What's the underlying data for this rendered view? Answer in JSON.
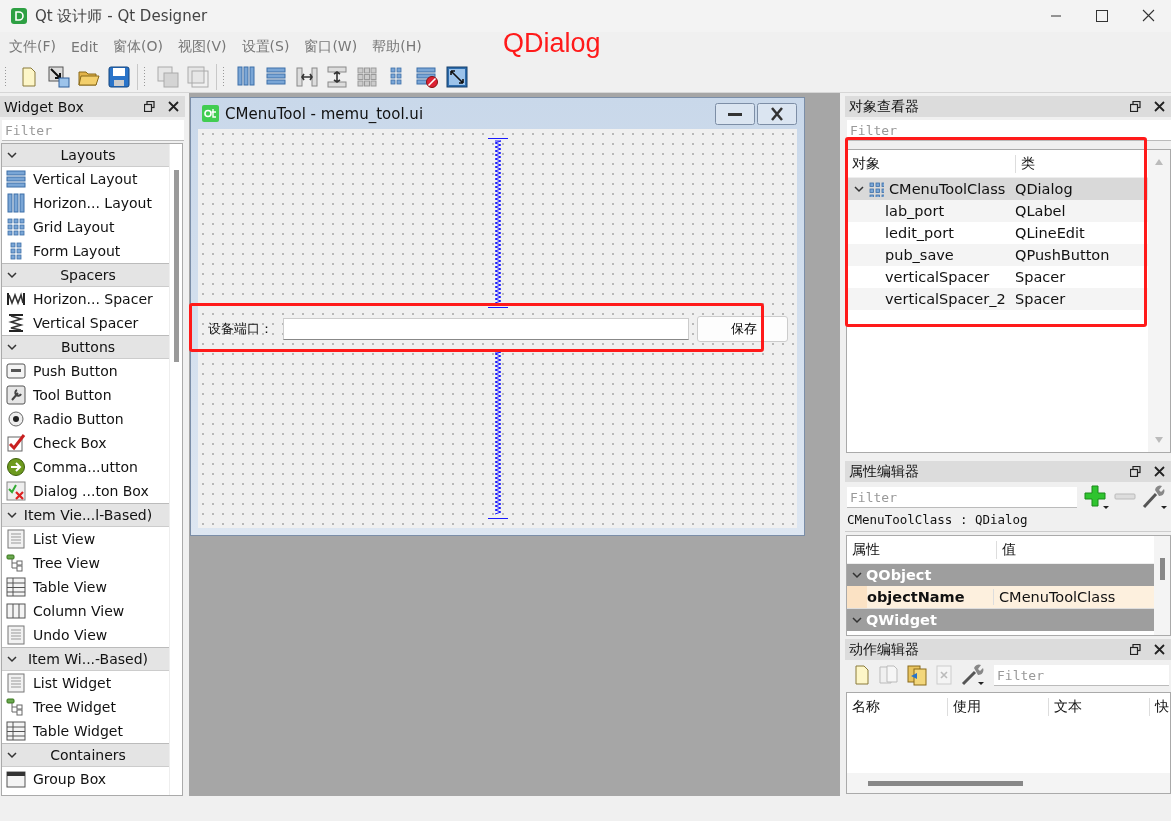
{
  "window": {
    "title": "Qt 设计师 - Qt Designer"
  },
  "menu": [
    {
      "label": "文件(F)"
    },
    {
      "label": "Edit"
    },
    {
      "label": "窗体(O)"
    },
    {
      "label": "视图(V)"
    },
    {
      "label": "设置(S)"
    },
    {
      "label": "窗口(W)"
    },
    {
      "label": "帮助(H)"
    }
  ],
  "annotation": {
    "text": "QDialog"
  },
  "widget_box": {
    "title": "Widget Box",
    "filter_placeholder": "Filter",
    "sections": [
      {
        "title": "Layouts",
        "expanded": true,
        "items": [
          {
            "label": "Vertical Layout",
            "kind": "vlayout"
          },
          {
            "label": "Horizon... Layout",
            "kind": "hlayout"
          },
          {
            "label": "Grid Layout",
            "kind": "grid"
          },
          {
            "label": "Form Layout",
            "kind": "form"
          }
        ]
      },
      {
        "title": "Spacers",
        "expanded": true,
        "items": [
          {
            "label": "Horizon... Spacer",
            "kind": "hspacer"
          },
          {
            "label": "Vertical Spacer",
            "kind": "vspacer"
          }
        ]
      },
      {
        "title": "Buttons",
        "expanded": true,
        "items": [
          {
            "label": "Push Button",
            "kind": "push"
          },
          {
            "label": "Tool Button",
            "kind": "tool"
          },
          {
            "label": "Radio Button",
            "kind": "radio"
          },
          {
            "label": "Check Box",
            "kind": "check"
          },
          {
            "label": "Comma...utton",
            "kind": "command"
          },
          {
            "label": "Dialog ...ton Box",
            "kind": "dialogbox"
          }
        ]
      },
      {
        "title": "Item Vie...l-Based)",
        "expanded": true,
        "items": [
          {
            "label": "List View",
            "kind": "list"
          },
          {
            "label": "Tree View",
            "kind": "tree"
          },
          {
            "label": "Table View",
            "kind": "table"
          },
          {
            "label": "Column View",
            "kind": "column"
          },
          {
            "label": "Undo View",
            "kind": "list"
          }
        ]
      },
      {
        "title": "Item Wi...-Based)",
        "expanded": true,
        "items": [
          {
            "label": "List Widget",
            "kind": "list"
          },
          {
            "label": "Tree Widget",
            "kind": "tree"
          },
          {
            "label": "Table Widget",
            "kind": "table"
          }
        ]
      },
      {
        "title": "Containers",
        "expanded": true,
        "items": [
          {
            "label": "Group Box",
            "kind": "groupbox"
          }
        ]
      }
    ]
  },
  "form_window": {
    "title": "CMenuTool - memu_tool.ui",
    "label": "设备端口：",
    "button": "保存"
  },
  "object_inspector": {
    "title": "对象查看器",
    "filter_placeholder": "Filter",
    "columns": [
      "对象",
      "类"
    ],
    "tree": [
      {
        "name": "CMenuToolClass",
        "class": "QDialog",
        "expanded": true,
        "selected": true,
        "children": [
          {
            "name": "lab_port",
            "class": "QLabel",
            "selected": false
          },
          {
            "name": "ledit_port",
            "class": "QLineEdit",
            "selected": false
          },
          {
            "name": "pub_save",
            "class": "QPushButton",
            "selected": false
          },
          {
            "name": "verticalSpacer",
            "class": "Spacer",
            "selected": false
          },
          {
            "name": "verticalSpacer_2",
            "class": "Spacer",
            "selected": false
          }
        ]
      }
    ]
  },
  "property_editor": {
    "title": "属性编辑器",
    "filter_placeholder": "Filter",
    "object_label": "CMenuToolClass : QDialog",
    "columns": [
      "属性",
      "值"
    ],
    "groups": [
      {
        "name": "QObject",
        "expanded": true,
        "properties": [
          {
            "name": "objectName",
            "value": "CMenuToolClass",
            "changed": true
          }
        ]
      },
      {
        "name": "QWidget",
        "expanded": true
      }
    ]
  },
  "action_editor": {
    "title": "动作编辑器",
    "filter_placeholder": "Filter",
    "columns": [
      "名称",
      "使用",
      "文本",
      "快"
    ]
  }
}
